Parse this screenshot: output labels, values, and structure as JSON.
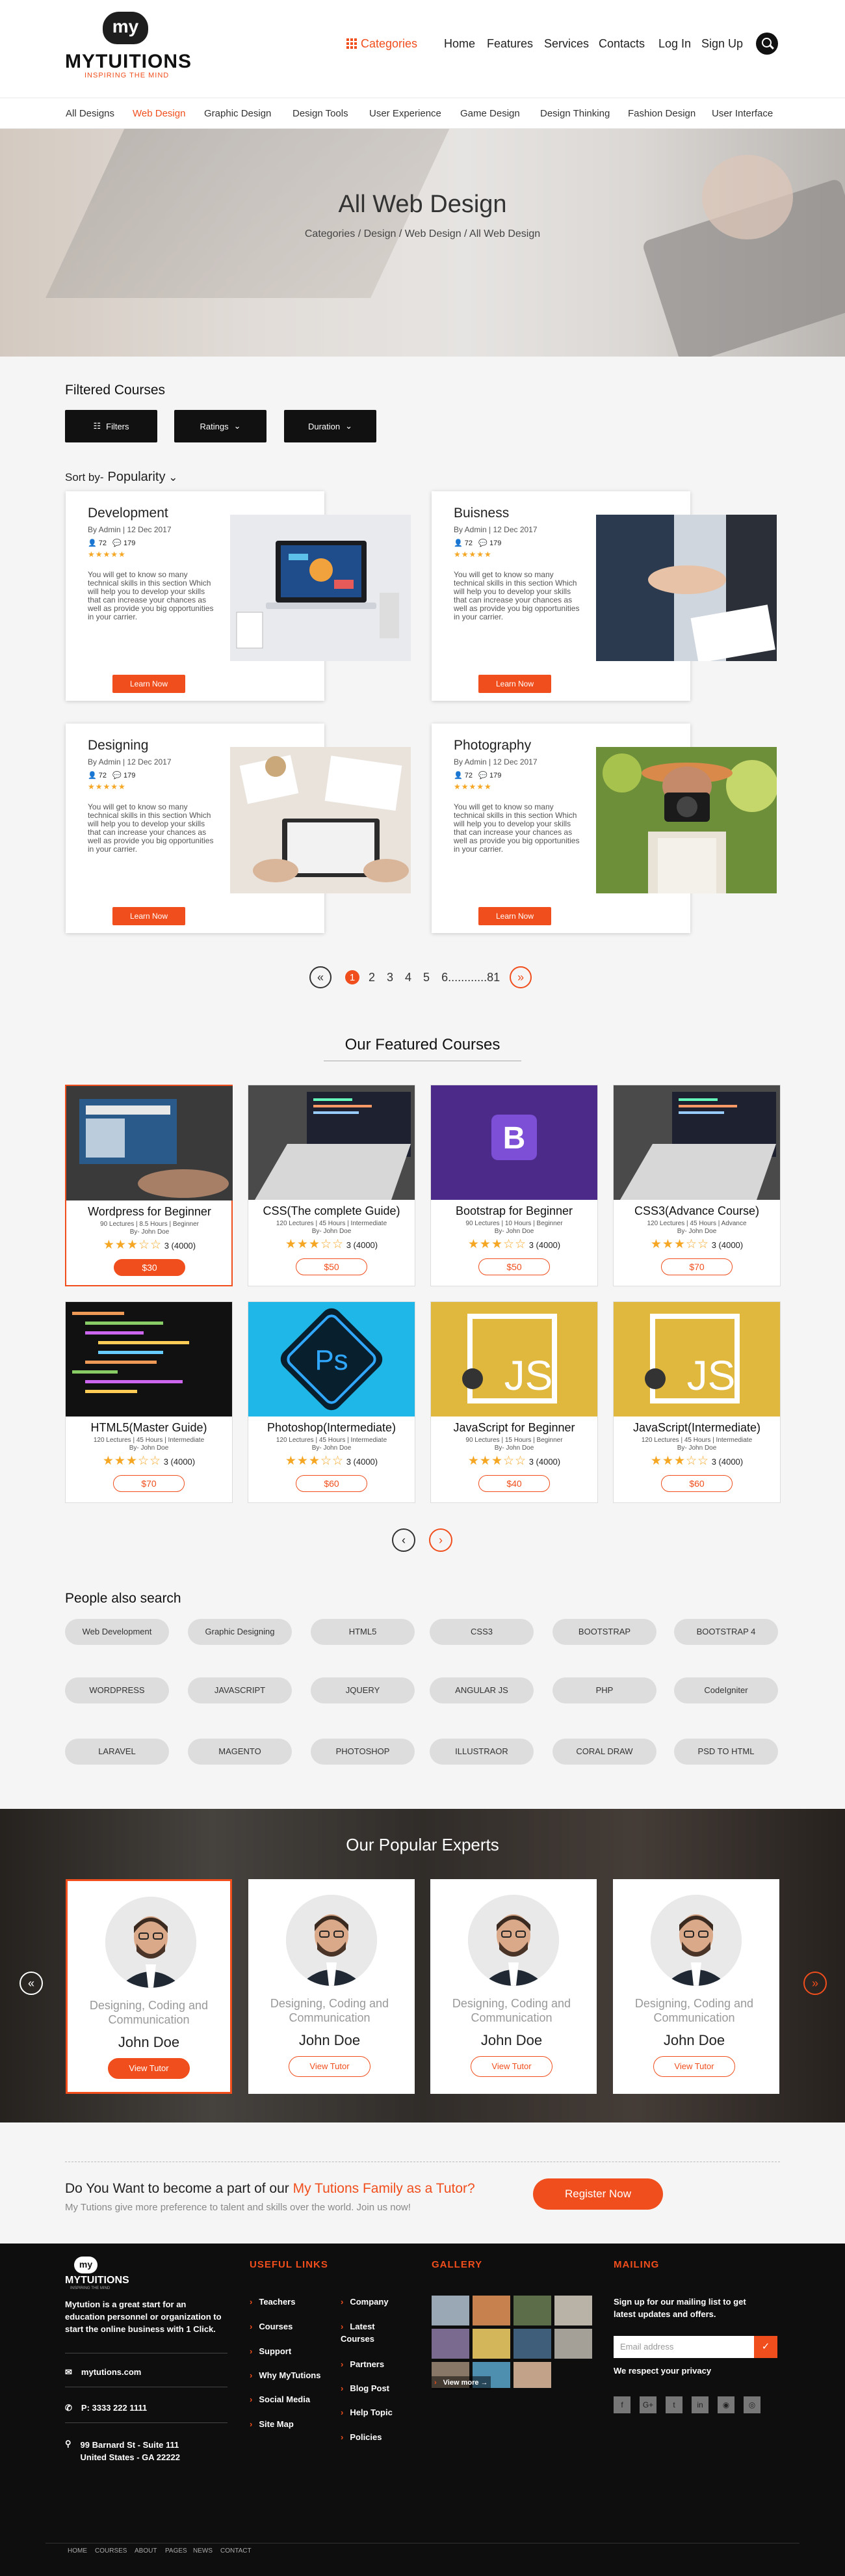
{
  "brand": {
    "mark": "my",
    "name": "MYTUITIONS",
    "tagline": "INSPIRING THE MIND"
  },
  "nav": {
    "categories": "Categories",
    "home": "Home",
    "features": "Features",
    "services": "Services",
    "contacts": "Contacts",
    "login": "Log In",
    "signup": "Sign Up"
  },
  "subnav": [
    "All Designs",
    "Web Design",
    "Graphic Design",
    "Design Tools",
    "User Experience",
    "Game Design",
    "Design Thinking",
    "Fashion Design",
    "User Interface"
  ],
  "hero": {
    "title": "All Web Design",
    "breadcrumb": "Categories / Design / Web Design / All Web Design"
  },
  "filters": {
    "title": "Filtered Courses",
    "filters": "Filters",
    "ratings": "Ratings",
    "duration": "Duration",
    "sort_label": "Sort by-",
    "sort_value": "Popularity"
  },
  "courses": [
    {
      "title": "Development",
      "meta": "By Admin | 12 Dec 2017",
      "students": "72",
      "comments": "179",
      "desc": "You will get to know so many technical skills in this section Which will help you to develop your skills that can increase your chances as well as provide you big opportunities in your carrier.",
      "button": "Learn Now"
    },
    {
      "title": "Buisness",
      "meta": "By Admin | 12 Dec 2017",
      "students": "72",
      "comments": "179",
      "desc": "You will get to know so many technical skills in this section Which will help you to develop your skills that can increase your chances as well as provide you big opportunities in your carrier.",
      "button": "Learn Now"
    },
    {
      "title": "Designing",
      "meta": "By Admin | 12 Dec 2017",
      "students": "72",
      "comments": "179",
      "desc": "You will get to know so many technical skills in this section Which will help you to develop your skills that can increase your chances as well as provide you big opportunities in your carrier.",
      "button": "Learn Now"
    },
    {
      "title": "Photography",
      "meta": "By Admin | 12 Dec 2017",
      "students": "72",
      "comments": "179",
      "desc": "You will get to know so many technical skills in this section Which will help you to develop your skills that can increase your chances as well as provide you big opportunities in your carrier.",
      "button": "Learn Now"
    }
  ],
  "pagination": {
    "pages": [
      "1",
      "2",
      "3",
      "4",
      "5",
      "6",
      "81"
    ],
    "ellipsis": "............"
  },
  "featured": {
    "title": "Our Featured Courses",
    "items": [
      {
        "title": "Wordpress for Beginner",
        "meta": "90 Lectures | 8.5 Hours | Beginner",
        "by": "By-  John Doe",
        "rating": "3 (4000)",
        "price": "$30"
      },
      {
        "title": "CSS(The complete Guide)",
        "meta": "120 Lectures | 45 Hours | Intermediate",
        "by": "By-  John Doe",
        "rating": "3 (4000)",
        "price": "$50"
      },
      {
        "title": "Bootstrap for Beginner",
        "meta": "90 Lectures | 10 Hours | Beginner",
        "by": "By-  John Doe",
        "rating": "3 (4000)",
        "price": "$50"
      },
      {
        "title": "CSS3(Advance Course)",
        "meta": "120 Lectures | 45 Hours | Advance",
        "by": "By-  John Doe",
        "rating": "3 (4000)",
        "price": "$70"
      },
      {
        "title": "HTML5(Master Guide)",
        "meta": "120 Lectures | 45 Hours | Intermediate",
        "by": "By-  John Doe",
        "rating": "3 (4000)",
        "price": "$70"
      },
      {
        "title": "Photoshop(Intermediate)",
        "meta": "120 Lectures | 45 Hours | Intermediate",
        "by": "By-  John Doe",
        "rating": "3 (4000)",
        "price": "$60"
      },
      {
        "title": "JavaScript for Beginner",
        "meta": "90 Lectures | 15 Hours | Beginner",
        "by": "By-  John Doe",
        "rating": "3 (4000)",
        "price": "$40"
      },
      {
        "title": "JavaScript(Intermediate)",
        "meta": "120 Lectures | 45 Hours | Intermediate",
        "by": "By-  John Doe",
        "rating": "3 (4000)",
        "price": "$60"
      }
    ]
  },
  "search": {
    "title": "People also search",
    "tags": [
      "Web Development",
      "Graphic Designing",
      "HTML5",
      "CSS3",
      "BOOTSTRAP",
      "BOOTSTRAP 4",
      "WORDPRESS",
      "JAVASCRIPT",
      "JQUERY",
      "ANGULAR JS",
      "PHP",
      "CodeIgniter",
      "LARAVEL",
      "MAGENTO",
      "PHOTOSHOP",
      "ILLUSTRAOR",
      "CORAL DRAW",
      "PSD TO HTML"
    ]
  },
  "experts": {
    "title": "Our Popular Experts",
    "items": [
      {
        "role": "Designing, Coding and Communication",
        "name": "John Doe",
        "button": "View Tutor"
      },
      {
        "role": "Designing, Coding and Communication",
        "name": "John Doe",
        "button": "View Tutor"
      },
      {
        "role": "Designing, Coding and Communication",
        "name": "John Doe",
        "button": "View Tutor"
      },
      {
        "role": "Designing, Coding and Communication",
        "name": "John Doe",
        "button": "View Tutor"
      }
    ]
  },
  "cta": {
    "question_pre": "Do You Want to become a part of our ",
    "question_hl": "My Tutions Family as a Tutor?",
    "sub": "My Tutions give more preference to talent and skills over the world. Join us now!",
    "button": "Register Now"
  },
  "footer": {
    "about": "Mytution is a great start for an education personnel or organization to start the online business with 1 Click.",
    "website": "mytutions.com",
    "phone": "P: 3333 222 1111",
    "address": "99 Barnard St - Suite 111 United States - GA 22222",
    "useful_title": "USEFUL LINKS",
    "links1": [
      "Teachers",
      "Courses",
      "Support",
      "Why MyTutions",
      "Social Media",
      "Site Map"
    ],
    "links2": [
      "Company",
      "Latest Courses",
      "Partners",
      "Blog Post",
      "Help Topic",
      "Policies"
    ],
    "gallery_title": "GALLERY",
    "view_more": "View more →",
    "mailing_title": "MAILING",
    "mailing_text": "Sign up for our mailing list to get latest updates and offers.",
    "email_placeholder": "Email address",
    "respect": "We respect your privacy",
    "social": [
      "f",
      "G+",
      "t",
      "in",
      "◉",
      "◎"
    ],
    "bottom": [
      "HOME",
      "COURSES",
      "ABOUT",
      "PAGES",
      "NEWS",
      "CONTACT"
    ]
  },
  "colors": {
    "accent": "#f04e1c",
    "dark": "#0e0e0e",
    "star": "#f5a623"
  }
}
